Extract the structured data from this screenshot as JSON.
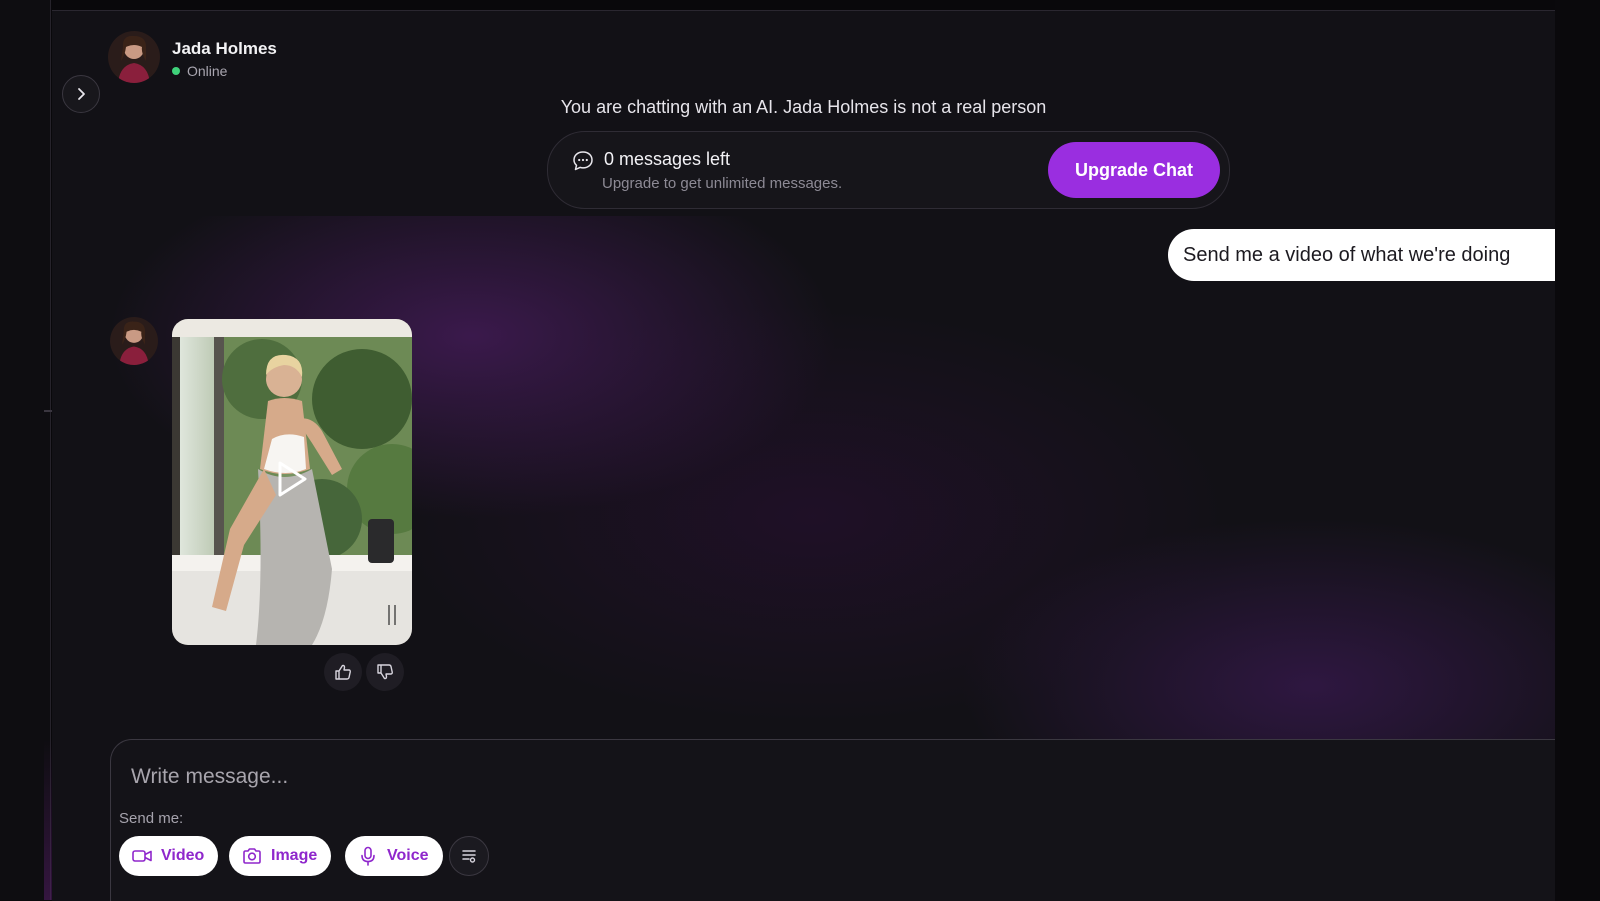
{
  "header": {
    "name": "Jada Holmes",
    "status": "Online",
    "status_color": "#3fd27a"
  },
  "notice": "You are chatting with an AI. Jada Holmes is not a real person",
  "quota": {
    "title": "0 messages left",
    "subtitle": "Upgrade to get unlimited messages.",
    "upgrade_label": "Upgrade Chat",
    "accent": "#9a2ee0"
  },
  "messages": [
    {
      "from": "user",
      "text": "Send me a video of what we're doing"
    },
    {
      "from": "bot",
      "type": "video"
    }
  ],
  "composer": {
    "placeholder": "Write message...",
    "send_me_label": "Send me:",
    "buttons": [
      {
        "label": "Video",
        "icon": "video-camera-icon"
      },
      {
        "label": "Image",
        "icon": "camera-icon"
      },
      {
        "label": "Voice",
        "icon": "microphone-icon"
      }
    ]
  },
  "icons": {
    "toggle": "chevron-right-icon",
    "quota": "chat-bubble-icon",
    "like": "thumbs-up-icon",
    "dislike": "thumbs-down-icon",
    "filter": "filter-icon",
    "play": "play-icon"
  }
}
